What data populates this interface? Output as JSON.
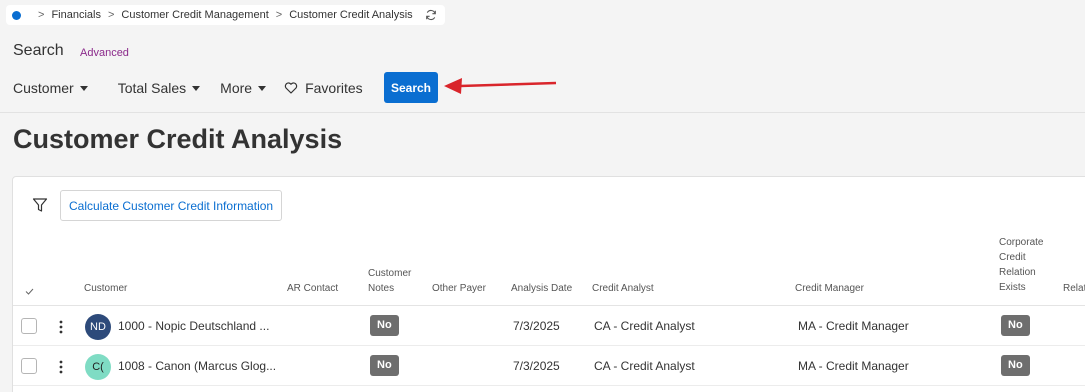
{
  "breadcrumb": {
    "items": [
      "Financials",
      "Customer Credit Management",
      "Customer Credit Analysis"
    ],
    "separator": ">"
  },
  "search": {
    "title": "Search",
    "advanced_label": "Advanced",
    "filters": [
      {
        "label": "Customer",
        "icon": "caret-down-icon"
      },
      {
        "label": "Total Sales",
        "icon": "caret-down-icon"
      },
      {
        "label": "More",
        "icon": "caret-down-icon"
      },
      {
        "label": "Favorites",
        "icon": "heart-icon"
      }
    ],
    "button_label": "Search"
  },
  "page": {
    "title": "Customer Credit Analysis"
  },
  "table": {
    "action_button": "Calculate Customer Credit Information",
    "columns": {
      "customer": "Customer",
      "ar_contact": "AR Contact",
      "customer_notes": "Customer Notes",
      "other_payer": "Other Payer",
      "analysis_date": "Analysis Date",
      "credit_analyst": "Credit Analyst",
      "credit_manager": "Credit Manager",
      "corporate_relation": "Corporate Credit Relation Exists",
      "relation_truncated": "Relat"
    },
    "rows": [
      {
        "avatar": "ND",
        "avatar_color": "#2d4a7a",
        "customer": "1000 - Nopic Deutschland ...",
        "notes": "No",
        "analysis_date": "7/3/2025",
        "credit_analyst": "CA - Credit Analyst",
        "credit_manager": "MA - Credit Manager",
        "corporate_relation": "No"
      },
      {
        "avatar": "C(",
        "avatar_color": "#7fdcc4",
        "customer": "1008 - Canon (Marcus Glog...",
        "notes": "No",
        "analysis_date": "7/3/2025",
        "credit_analyst": "CA - Credit Analyst",
        "credit_manager": "MA - Credit Manager",
        "corporate_relation": "No"
      }
    ]
  },
  "colors": {
    "accent": "#0a6ed1",
    "advanced_link": "#8b2a8b",
    "badge": "#6e6e6e",
    "annotation_arrow": "#d9252b"
  }
}
